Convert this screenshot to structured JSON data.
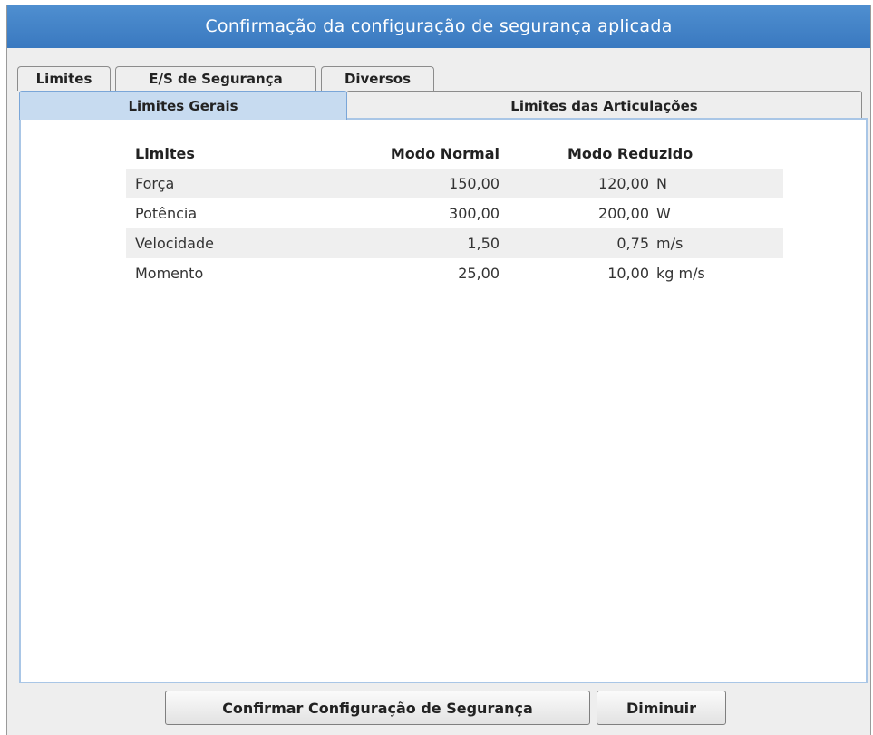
{
  "window": {
    "title": "Confirmação da configuração de segurança aplicada"
  },
  "tabs": [
    {
      "label": "Limites",
      "active": true
    },
    {
      "label": "E/S de Segurança",
      "active": false
    },
    {
      "label": "Diversos",
      "active": false
    }
  ],
  "subtabs": [
    {
      "label": "Limites Gerais",
      "active": true
    },
    {
      "label": "Limites das Articulações",
      "active": false
    }
  ],
  "table": {
    "headers": {
      "name": "Limites",
      "normal": "Modo Normal",
      "reduced": "Modo Reduzido"
    },
    "rows": [
      {
        "name": "Força",
        "normal": "150,00",
        "reduced": "120,00",
        "unit": "N"
      },
      {
        "name": "Potência",
        "normal": "300,00",
        "reduced": "200,00",
        "unit": "W"
      },
      {
        "name": "Velocidade",
        "normal": "1,50",
        "reduced": "0,75",
        "unit": "m/s"
      },
      {
        "name": "Momento",
        "normal": "25,00",
        "reduced": "10,00",
        "unit": "kg m/s"
      }
    ]
  },
  "buttons": {
    "confirm": "Confirmar Configuração de Segurança",
    "decrease": "Diminuir"
  },
  "colors": {
    "titlebar": "#3f82c6",
    "active_subtab": "#c7dbf0",
    "row_shade": "#efefef"
  }
}
